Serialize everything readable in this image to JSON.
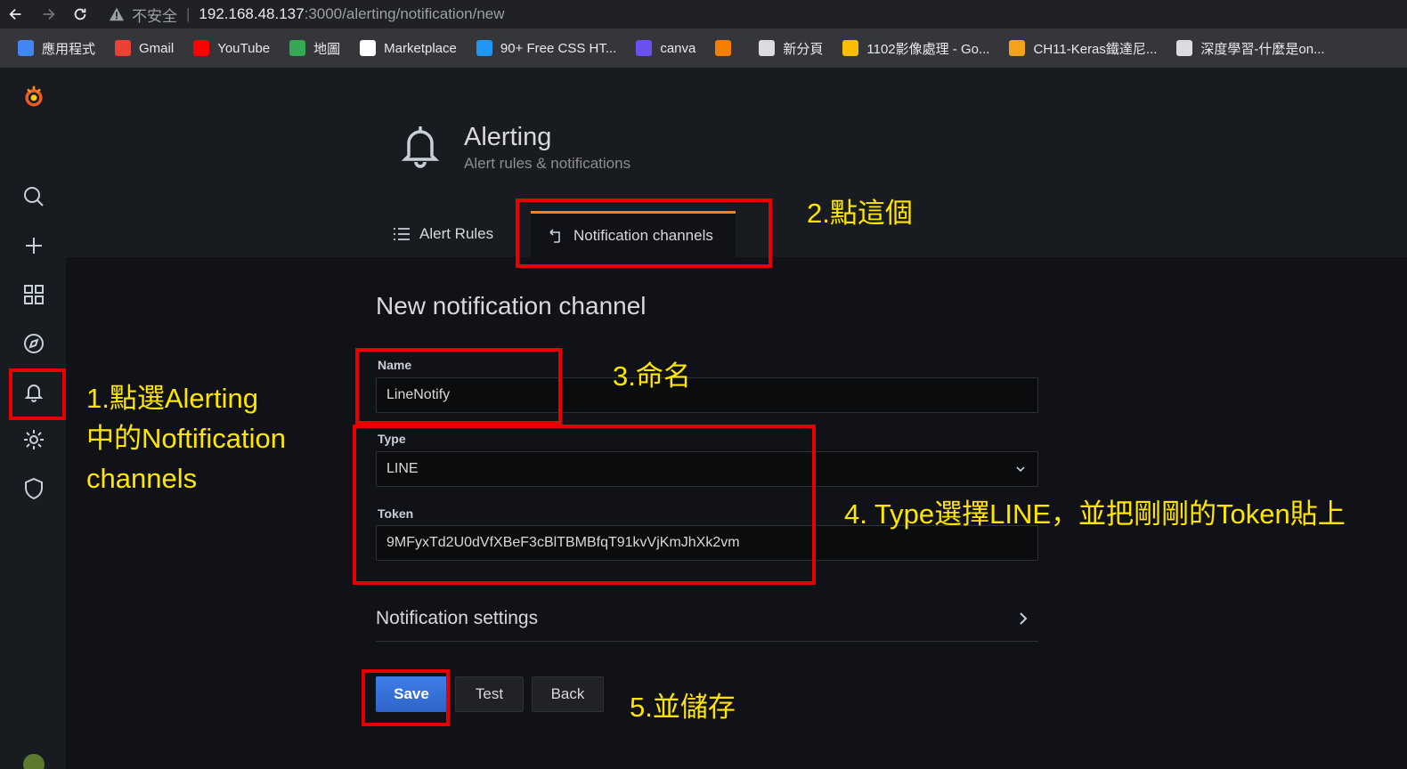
{
  "browser": {
    "insecure_label": "不安全",
    "url_host": "192.168.48.137",
    "url_path": ":3000/alerting/notification/new",
    "bookmarks": [
      {
        "label": "應用程式",
        "icon": "apps-grid-icon",
        "color": "#4285f4"
      },
      {
        "label": "Gmail",
        "icon": "gmail-icon",
        "color": "#ea4335"
      },
      {
        "label": "YouTube",
        "icon": "youtube-icon",
        "color": "#ff0000"
      },
      {
        "label": "地圖",
        "icon": "maps-icon",
        "color": "#34a853"
      },
      {
        "label": "Marketplace",
        "icon": "github-icon",
        "color": "#ffffff"
      },
      {
        "label": "90+ Free CSS HT...",
        "icon": "play-icon",
        "color": "#2196f3"
      },
      {
        "label": "canva",
        "icon": "canva-icon",
        "color": "#6b4ff0"
      },
      {
        "label": "",
        "icon": "blogger-icon",
        "color": "#f57d00"
      },
      {
        "label": "新分頁",
        "icon": "globe-icon",
        "color": "#dadce0"
      },
      {
        "label": "1102影像處理 - Go...",
        "icon": "drive-icon",
        "color": "#fbbc04"
      },
      {
        "label": "CH11-Keras鐵達尼...",
        "icon": "book-icon",
        "color": "#f4a21b"
      },
      {
        "label": "深度學習-什麼是on...",
        "icon": "globe-icon",
        "color": "#dadce0"
      }
    ]
  },
  "page": {
    "title": "Alerting",
    "subtitle": "Alert rules & notifications",
    "tabs": [
      {
        "label": "Alert Rules",
        "icon": "list-icon"
      },
      {
        "label": "Notification channels",
        "icon": "share-icon"
      }
    ],
    "section_title": "New notification channel"
  },
  "form": {
    "name_label": "Name",
    "name_value": "LineNotify",
    "type_label": "Type",
    "type_value": "LINE",
    "token_label": "Token",
    "token_value": "9MFyxTd2U0dVfXBeF3cBlTBMBfqT91kvVjKmJhXk2vm",
    "settings_label": "Notification settings",
    "save_label": "Save",
    "test_label": "Test",
    "back_label": "Back"
  },
  "annotations": {
    "step1_line1": "1.點選Alerting",
    "step1_line2": "中的Noftification",
    "step1_line3": "channels",
    "step2": "2.點這個",
    "step3": "3.命名",
    "step4": "4. Type選擇LINE，並把剛剛的Token貼上",
    "step5": "5.並儲存",
    "box_color": "#e60000",
    "text_color": "#ffe600"
  },
  "theme": {
    "accent": "#f5821f",
    "primary": "#3871dc"
  }
}
